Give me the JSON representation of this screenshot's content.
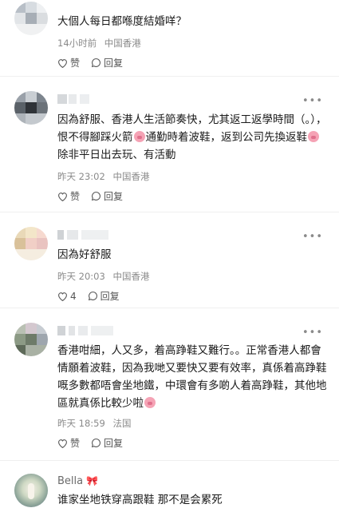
{
  "comments": [
    {
      "text": "大個人每日都喺度結婚咩？",
      "time": "14小时前",
      "location": "中国香港",
      "like_label": "赞",
      "reply_label": "回复",
      "like_count": ""
    },
    {
      "text_parts": [
        "因為舒服、香港人生活節奏快，尤其返工返學時間（。），恨不得腳踩火箭",
        "通勤時着波鞋，返到公司先換返鞋",
        "除非平日出去玩、有活動"
      ],
      "time": "昨天 23:02",
      "location": "中国香港",
      "like_label": "赞",
      "reply_label": "回复",
      "like_count": ""
    },
    {
      "text": "因為好舒服",
      "time": "昨天 20:03",
      "location": "中国香港",
      "like_label": "",
      "reply_label": "回复",
      "like_count": "4"
    },
    {
      "text_parts": [
        "香港咁細，人又多，着高踭鞋又難行。。正常香港人都會情願着波鞋，因為我哋又要快又要有效率，真係着高踭鞋嘅多數都唔會坐地鐵，中環會有多啲人着高踭鞋，其他地區就真係比較少啦",
        ""
      ],
      "time": "昨天 18:59",
      "location": "法国",
      "like_label": "赞",
      "reply_label": "回复",
      "like_count": ""
    },
    {
      "username": "Bella",
      "text": "谁家坐地铁穿高跟鞋 那不是会累死"
    }
  ],
  "icons": {
    "like": "heart-icon",
    "reply": "comment-bubble-icon",
    "more": "ellipsis-icon",
    "emoji": "pig-face-emoji"
  },
  "colors": {
    "meta": "#8a8a8a",
    "divider": "#efefef",
    "text": "#1a1a1a"
  }
}
